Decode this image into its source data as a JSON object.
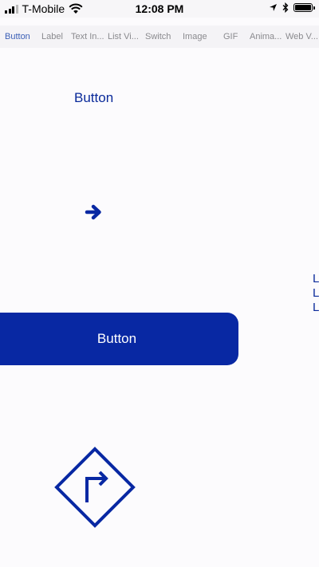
{
  "status_bar": {
    "carrier": "T-Mobile",
    "time": "12:08 PM",
    "icons": [
      "signal-icon",
      "wifi-icon",
      "location-icon",
      "bluetooth-icon",
      "battery-icon"
    ]
  },
  "tabs": [
    {
      "label": "Button",
      "active": true
    },
    {
      "label": "Label",
      "active": false
    },
    {
      "label": "Text In...",
      "active": false
    },
    {
      "label": "List Vi...",
      "active": false
    },
    {
      "label": "Switch",
      "active": false
    },
    {
      "label": "Image",
      "active": false
    },
    {
      "label": "GIF",
      "active": false
    },
    {
      "label": "Anima...",
      "active": false
    },
    {
      "label": "Web V...",
      "active": false
    }
  ],
  "content": {
    "text_button_label": "Button",
    "arrow_button_icon": "arrow-right-icon",
    "filled_button_label": "Button",
    "edge_letters": [
      "L",
      "L",
      "L"
    ],
    "diamond_button_icon": "turn-right-sign-icon"
  },
  "colors": {
    "accent": "#0828a3",
    "tab_active": "#3b5fb6",
    "tab_inactive": "#8a8a8e",
    "background": "#fcfbfd"
  }
}
